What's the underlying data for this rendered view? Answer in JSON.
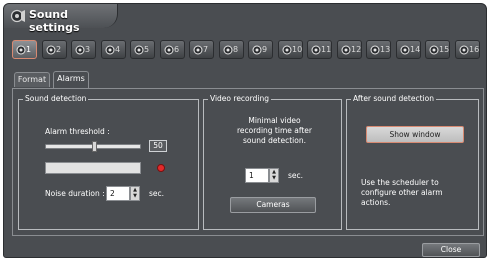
{
  "window": {
    "title": "Sound settings"
  },
  "channels": [
    {
      "num": "1",
      "active": true
    },
    {
      "num": "2",
      "active": false
    },
    {
      "num": "3",
      "active": false
    },
    {
      "num": "4",
      "active": false
    },
    {
      "num": "5",
      "active": false
    },
    {
      "num": "6",
      "active": false
    },
    {
      "num": "7",
      "active": false
    },
    {
      "num": "8",
      "active": false
    },
    {
      "num": "9",
      "active": false
    },
    {
      "num": "10",
      "active": false
    },
    {
      "num": "11",
      "active": false
    },
    {
      "num": "12",
      "active": false
    },
    {
      "num": "13",
      "active": false
    },
    {
      "num": "14",
      "active": false
    },
    {
      "num": "15",
      "active": false
    },
    {
      "num": "16",
      "active": false
    }
  ],
  "tabs": [
    {
      "label": "Format",
      "active": false
    },
    {
      "label": "Alarms",
      "active": true
    }
  ],
  "sound_detection": {
    "title": "Sound detection",
    "threshold_label": "Alarm threshold :",
    "threshold_value": "50",
    "threshold_level": 0.5,
    "noise_label": "Noise duration :",
    "noise_value": "2",
    "noise_unit": "sec."
  },
  "video_recording": {
    "title": "Video recording",
    "description": "Minimal video recording time after sound detection.",
    "value": "1",
    "unit": "sec.",
    "cameras_label": "Cameras"
  },
  "after_detection": {
    "title": "After sound detection",
    "show_window_label": "Show window",
    "hint": "Use the scheduler to configure other alarm actions."
  },
  "footer": {
    "close_label": "Close"
  },
  "colors": {
    "window_bg": "#4a4d51",
    "accent_border": "#d88a72",
    "level_dot": "#e22a2a"
  }
}
